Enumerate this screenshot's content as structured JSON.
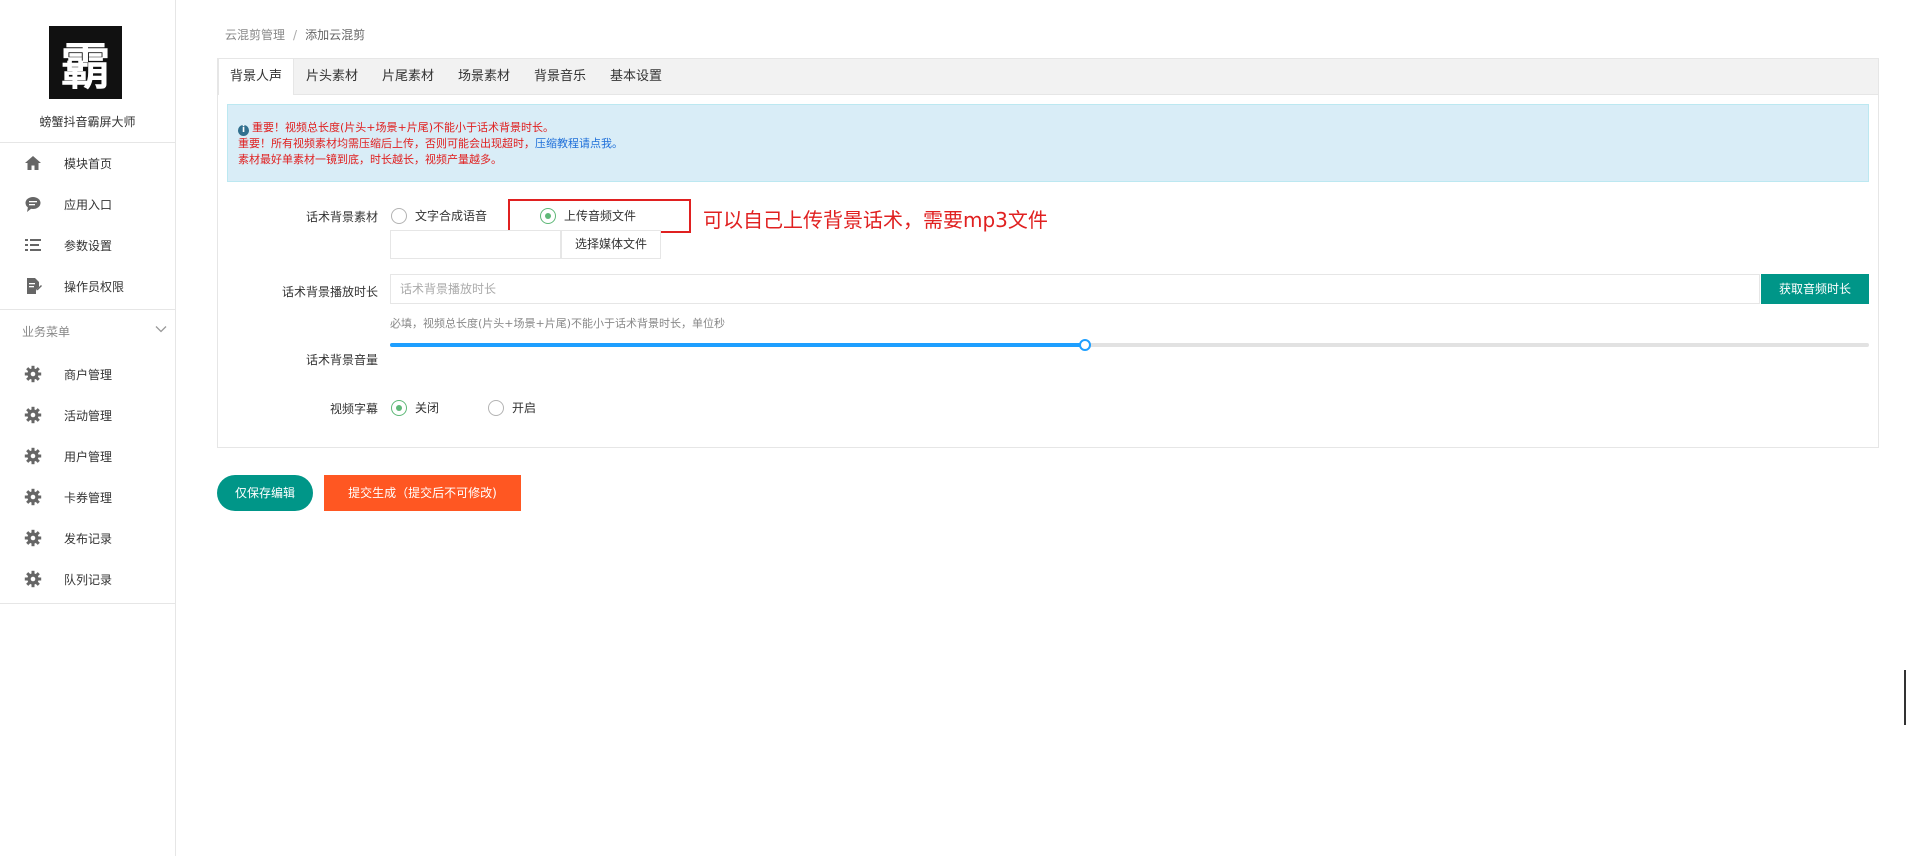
{
  "sidebar": {
    "logo_char": "霸",
    "brand": "螃蟹抖音霸屏大师",
    "items": [
      {
        "label": "模块首页",
        "icon": "home-icon"
      },
      {
        "label": "应用入口",
        "icon": "chat-icon"
      },
      {
        "label": "参数设置",
        "icon": "list-icon"
      },
      {
        "label": "操作员权限",
        "icon": "document-edit-icon"
      }
    ],
    "group_title": "业务菜单",
    "group_items": [
      {
        "label": "商户管理",
        "icon": "gear-icon"
      },
      {
        "label": "活动管理",
        "icon": "gear-icon"
      },
      {
        "label": "用户管理",
        "icon": "gear-icon"
      },
      {
        "label": "卡券管理",
        "icon": "gear-icon"
      },
      {
        "label": "发布记录",
        "icon": "gear-icon"
      },
      {
        "label": "队列记录",
        "icon": "gear-icon"
      }
    ]
  },
  "breadcrumb": {
    "parent": "云混剪管理",
    "sep": "/",
    "current": "添加云混剪"
  },
  "tabs": [
    "背景人声",
    "片头素材",
    "片尾素材",
    "场景素材",
    "背景音乐",
    "基本设置"
  ],
  "active_tab": 0,
  "alert": {
    "line1": "重要！视频总长度(片头+场景+片尾)不能小于话术背景时长。",
    "line2": "重要！所有视频素材均需压缩后上传，否则可能会出现超时，",
    "line2_link": "压缩教程请点我。",
    "line3": "素材最好单素材一镜到底，时长越长，视频产量越多。"
  },
  "form": {
    "bg_material_label": "话术背景素材",
    "option_tts": "文字合成语音",
    "option_upload": "上传音频文件",
    "selected_option": "upload",
    "annotation": "可以自己上传背景话术，需要mp3文件",
    "file_button": "选择媒体文件",
    "duration_label": "话术背景播放时长",
    "duration_placeholder": "话术背景播放时长",
    "duration_value": "",
    "get_duration_button": "获取音频时长",
    "duration_hint": "必填，视频总长度(片头+场景+片尾)不能小于话术背景时长，单位秒",
    "volume_label": "话术背景音量",
    "volume_fraction": 0.47,
    "subtitle_label": "视频字幕",
    "subtitle_off": "关闭",
    "subtitle_on": "开启",
    "subtitle_selected": "off"
  },
  "actions": {
    "save_only": "仅保存编辑",
    "submit": "提交生成（提交后不可修改)"
  },
  "colors": {
    "primary": "#009688",
    "danger": "#ff5722",
    "slider": "#1e9fff",
    "annotation": "#e02020"
  }
}
